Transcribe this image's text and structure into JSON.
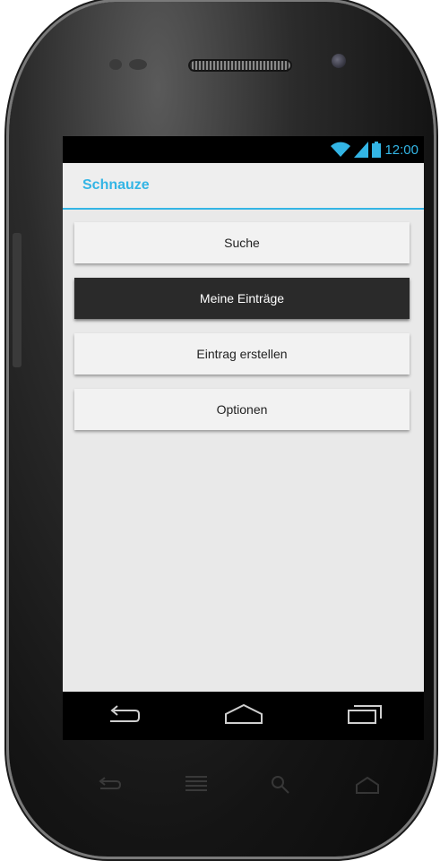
{
  "status_bar": {
    "time": "12:00",
    "icons": [
      "wifi-icon",
      "signal-icon",
      "battery-icon"
    ],
    "icon_color": "#33b5e5"
  },
  "action_bar": {
    "title": "Schnauze",
    "accent_color": "#33b5e5"
  },
  "menu": {
    "items": [
      {
        "label": "Suche",
        "selected": false
      },
      {
        "label": "Meine Einträge",
        "selected": true
      },
      {
        "label": "Eintrag erstellen",
        "selected": false
      },
      {
        "label": "Optionen",
        "selected": false
      }
    ]
  },
  "nav_bar": {
    "buttons": [
      "back-icon",
      "home-icon",
      "recent-apps-icon"
    ]
  },
  "hardware_keys": [
    "back-icon",
    "menu-icon",
    "search-icon",
    "home-icon"
  ]
}
